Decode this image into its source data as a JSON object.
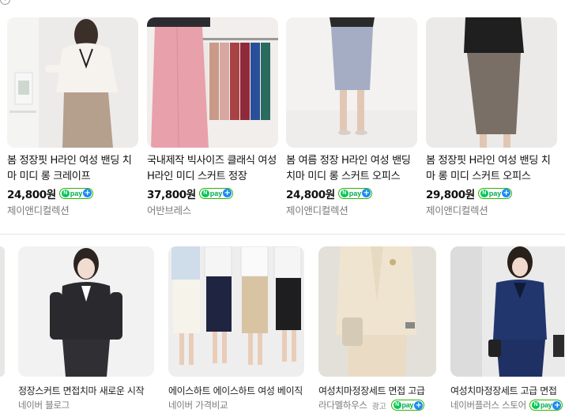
{
  "top_section": {
    "products": [
      {
        "title": "봄 정장핏 H라인 여성 밴딩 치마 미디 롱 크레이프",
        "price": "24,800원",
        "store": "제이앤디컬렉션",
        "npay": "pay"
      },
      {
        "title": "국내제작 빅사이즈 클래식 여성 H라인 미디 스커트 정장",
        "price": "37,800원",
        "store": "어반브레스",
        "npay": "pay"
      },
      {
        "title": "봄 여름 정장 H라인 여성 밴딩 치마 미디 롱 스커트 오피스",
        "price": "24,800원",
        "store": "제이앤디컬렉션",
        "npay": "pay"
      },
      {
        "title": "봄 정장핏 H라인 여성 밴딩 치마 롱 미디 스커트 오피스",
        "price": "29,800원",
        "store": "제이앤디컬렉션",
        "npay": "pay"
      }
    ]
  },
  "bottom_section": {
    "items": [
      {
        "title": "정장스커트 면접치마 새로운 시작",
        "source": "네이버 블로그"
      },
      {
        "title": "에이스하트 에이스하트 여성 베이직",
        "source": "네이버 가격비교"
      },
      {
        "title": "여성치마정장세트 면접 고급",
        "source": "라다멜하우스",
        "ad_label": "광고",
        "npay": "pay"
      },
      {
        "title": "여성치마정장세트 고급 면접",
        "source": "네이버플러스 스토어",
        "npay": "pay"
      }
    ]
  },
  "colors": {
    "npay_green": "#03c75a",
    "plus_blue": "#1a8bf5",
    "divider": "#e4e4e4"
  }
}
